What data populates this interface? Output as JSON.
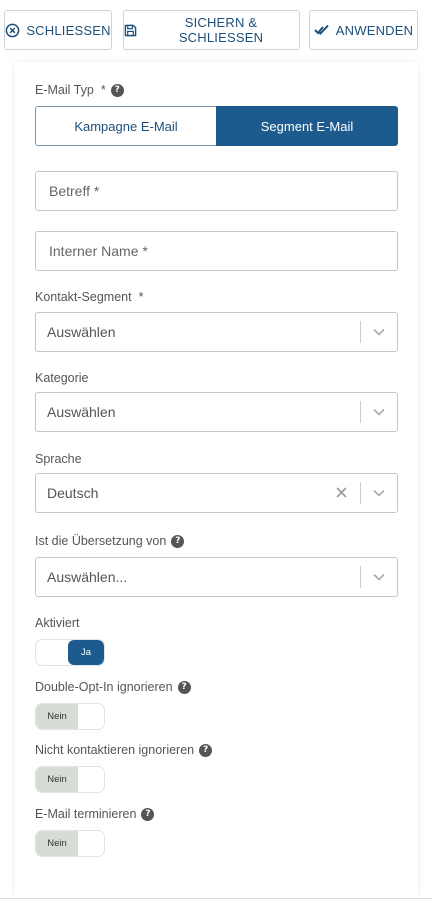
{
  "toolbar": {
    "close_label": "SCHLIESSEN",
    "save_close_label": "SICHERN & SCHLIESSEN",
    "apply_label": "ANWENDEN"
  },
  "form": {
    "email_type": {
      "label": "E-Mail Typ",
      "required_mark": "*",
      "options": [
        "Kampagne E-Mail",
        "Segment E-Mail"
      ],
      "selected": "Segment E-Mail"
    },
    "subject": {
      "placeholder": "Betreff *",
      "value": ""
    },
    "internal_name": {
      "placeholder": "Interner Name *",
      "value": ""
    },
    "contact_segment": {
      "label": "Kontakt-Segment",
      "required_mark": "*",
      "value": "Auswählen"
    },
    "category": {
      "label": "Kategorie",
      "value": "Auswählen"
    },
    "language": {
      "label": "Sprache",
      "value": "Deutsch"
    },
    "translation_of": {
      "label": "Ist die Übersetzung von",
      "value": "Auswählen..."
    },
    "activated": {
      "label": "Aktiviert",
      "state_label": "Ja",
      "on": true
    },
    "ignore_double_opt_in": {
      "label": "Double-Opt-In ignorieren",
      "state_label": "Nein",
      "on": false
    },
    "ignore_do_not_contact": {
      "label": "Nicht kontaktieren ignorieren",
      "state_label": "Nein",
      "on": false
    },
    "schedule_email": {
      "label": "E-Mail terminieren",
      "state_label": "Nein",
      "on": false
    }
  },
  "icons": {
    "help": "question-circle-icon",
    "close": "x-circle-icon",
    "save": "save-icon",
    "apply": "double-check-icon",
    "clear": "x-icon",
    "dropdown": "chevron-down-icon"
  },
  "colors": {
    "primary": "#1d5b8e",
    "toolbar_text": "#1d4f7a",
    "toggle_off": "#d6ddd6"
  }
}
